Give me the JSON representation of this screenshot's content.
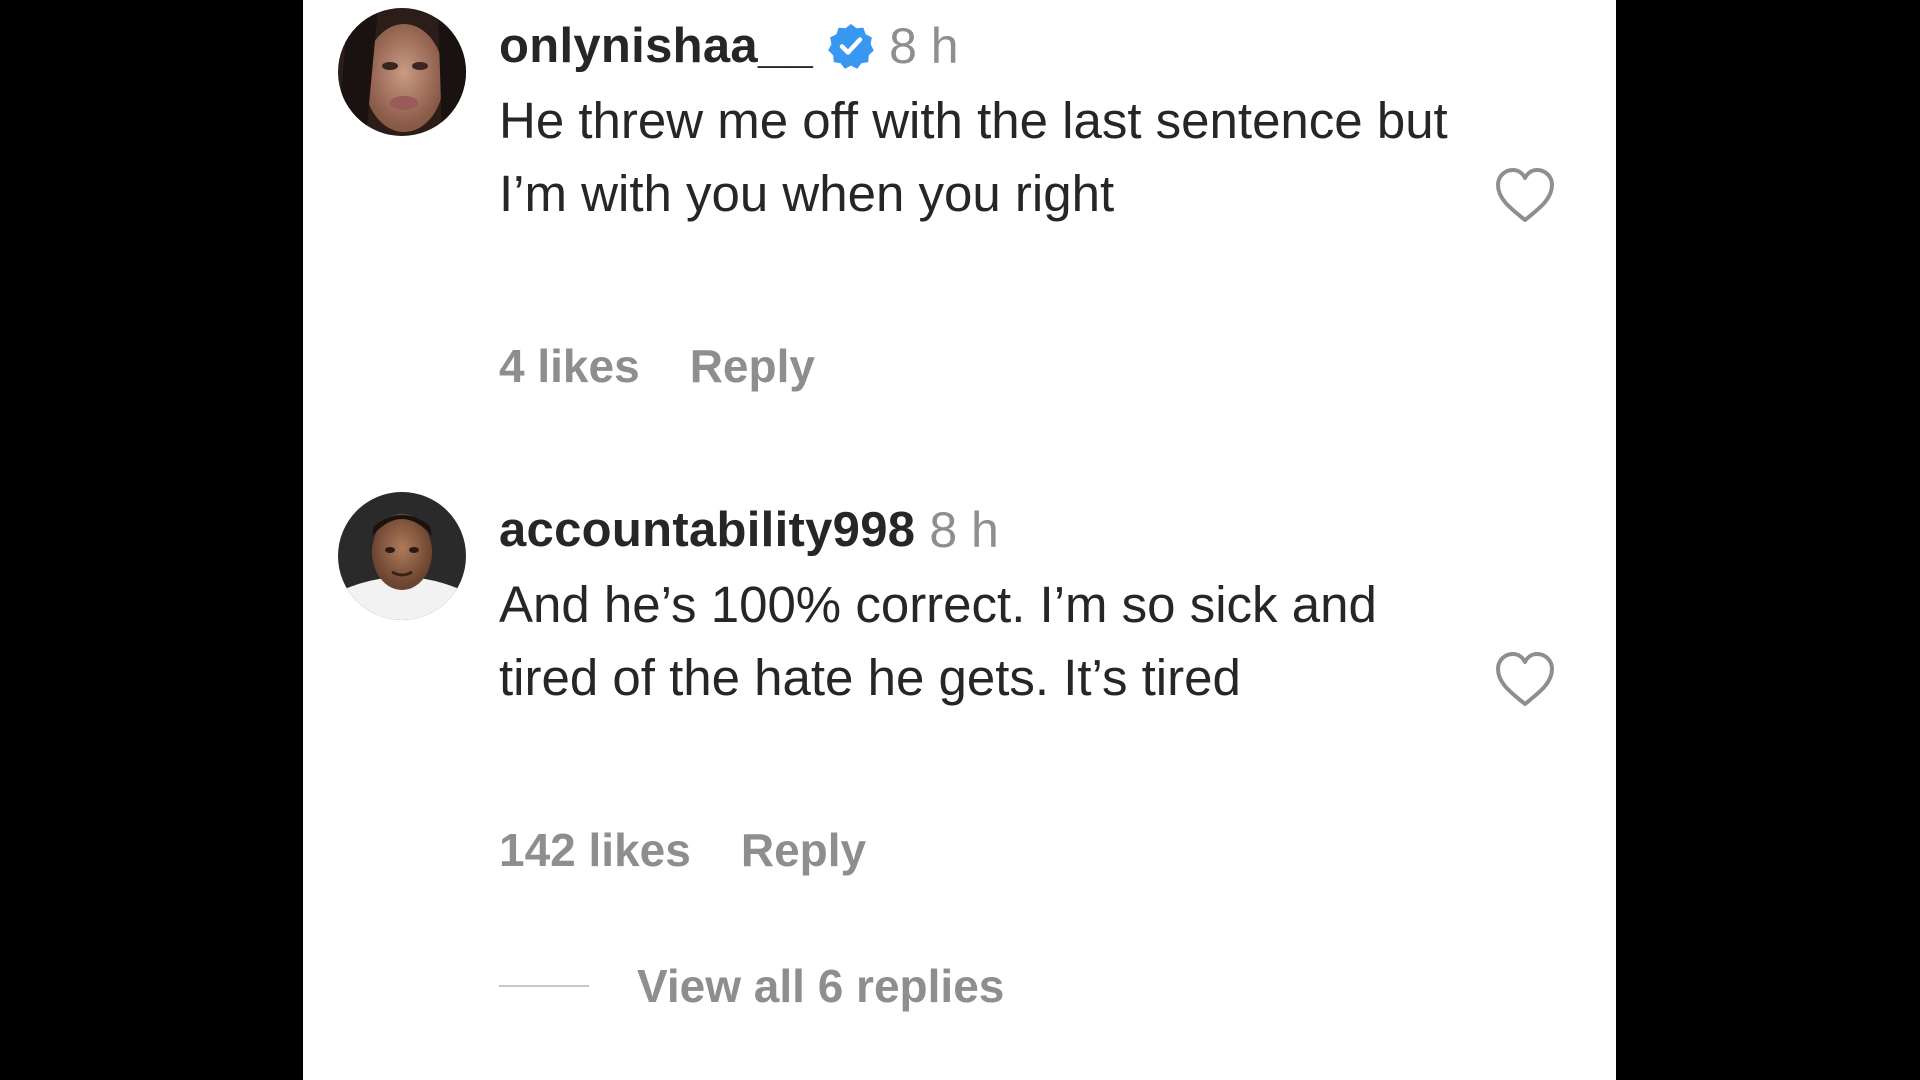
{
  "comments": [
    {
      "username": "onlynishaa__",
      "verified": true,
      "time": "8 h",
      "text": "He threw me off with the last sentence but I’m with you when you right",
      "likes": "4 likes",
      "reply_label": "Reply",
      "avatar_icon": "avatar-photo",
      "like_icon": "heart-outline-icon"
    },
    {
      "username": "accountability998",
      "verified": false,
      "time": "8 h",
      "text": "And he’s 100% correct. I’m so sick and tired of the hate he gets. It’s tired",
      "likes": "142 likes",
      "reply_label": "Reply",
      "avatar_icon": "avatar-photo",
      "like_icon": "heart-outline-icon"
    }
  ],
  "view_replies": {
    "label": "View all 6 replies"
  },
  "colors": {
    "background": "#000000",
    "panel": "#ffffff",
    "text_primary": "#262626",
    "text_secondary": "#8e8e8e",
    "verified_badge": "#3897f0"
  }
}
